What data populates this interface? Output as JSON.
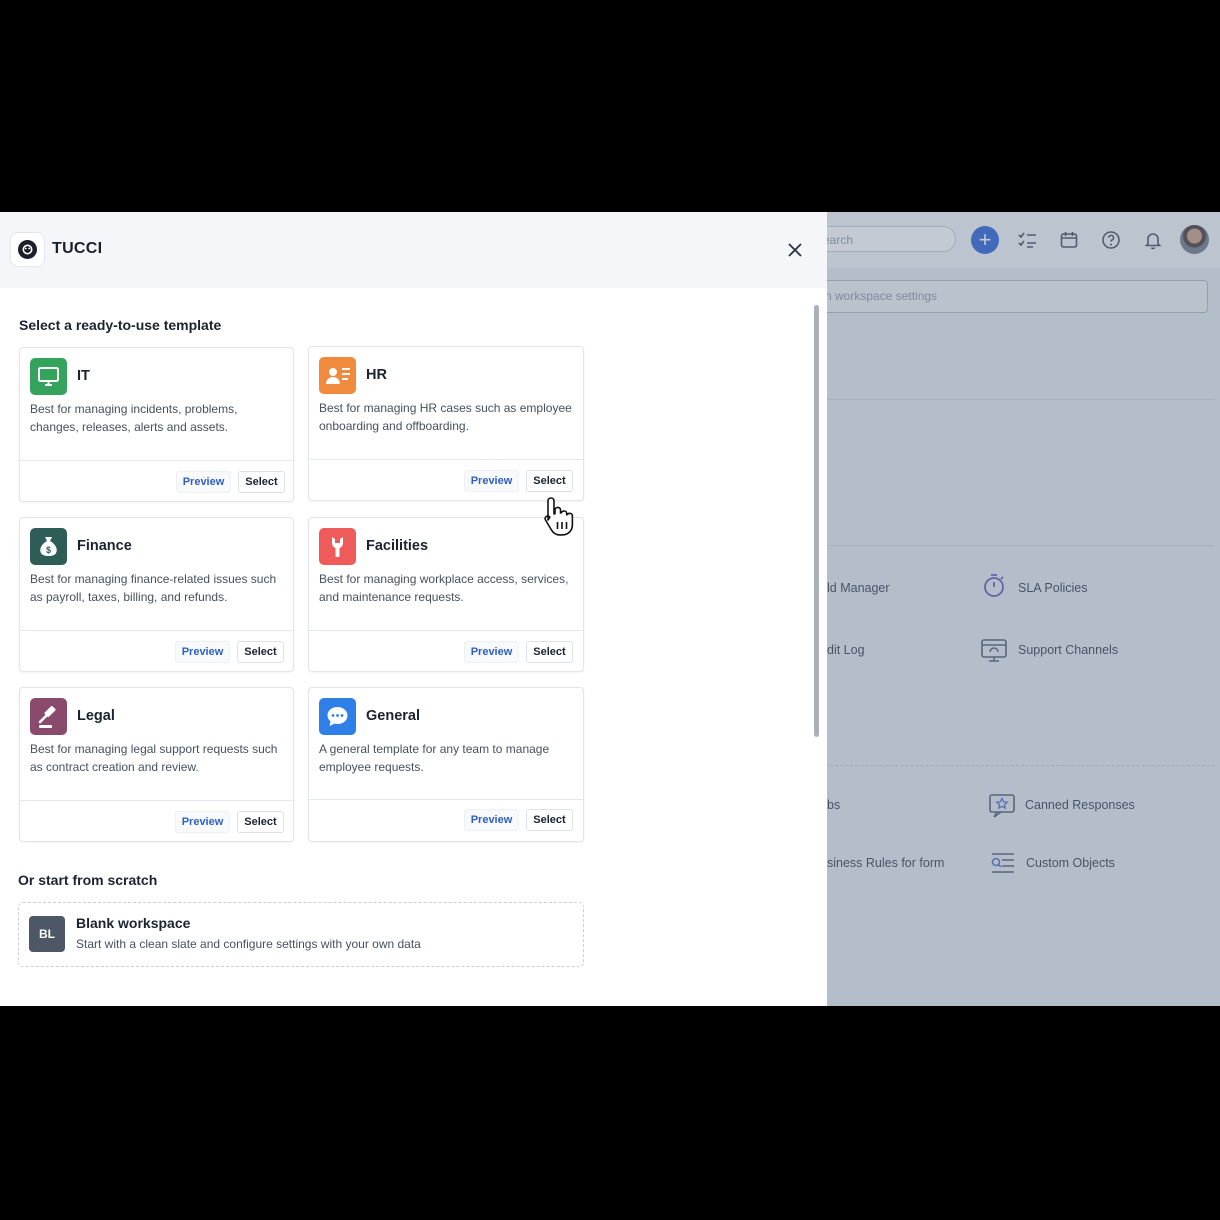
{
  "background_app": {
    "search_placeholder": "earch",
    "settings_search_placeholder": "rch workspace settings",
    "items": [
      {
        "label": "ld Manager"
      },
      {
        "label": "SLA Policies",
        "icon": "stopwatch-icon"
      },
      {
        "label": "dit Log"
      },
      {
        "label": "Support Channels",
        "icon": "support-channels-icon"
      },
      {
        "label": "bs"
      },
      {
        "label": "Canned Responses",
        "icon": "canned-responses-icon"
      },
      {
        "label": "siness Rules for form"
      },
      {
        "label": "Custom Objects",
        "icon": "custom-objects-icon"
      }
    ]
  },
  "modal": {
    "brand": "TUCCI",
    "section_title": "Select a ready-to-use template",
    "templates": [
      {
        "title": "IT",
        "description": "Best for managing incidents, problems, changes, releases, alerts and assets.",
        "icon": "monitor-icon",
        "color": "#34a35c",
        "preview_label": "Preview",
        "select_label": "Select"
      },
      {
        "title": "HR",
        "description": "Best for managing HR cases such as employee onboarding and offboarding.",
        "icon": "id-card-icon",
        "color": "#f08a3c",
        "preview_label": "Preview",
        "select_label": "Select"
      },
      {
        "title": "Finance",
        "description": "Best for managing finance-related issues such as payroll, taxes, billing, and refunds.",
        "icon": "money-bag-icon",
        "color": "#2e5d57",
        "preview_label": "Preview",
        "select_label": "Select"
      },
      {
        "title": "Facilities",
        "description": "Best for managing workplace access, services, and maintenance requests.",
        "icon": "wrench-icon",
        "color": "#ef5a5a",
        "preview_label": "Preview",
        "select_label": "Select"
      },
      {
        "title": "Legal",
        "description": "Best for managing legal support requests such as contract creation and review.",
        "icon": "gavel-icon",
        "color": "#8a4a6c",
        "preview_label": "Preview",
        "select_label": "Select"
      },
      {
        "title": "General",
        "description": "A general template for any team to manage employee requests.",
        "icon": "chat-bubble-icon",
        "color": "#2f7fe8",
        "preview_label": "Preview",
        "select_label": "Select"
      }
    ],
    "scratch_title": "Or start from scratch",
    "blank": {
      "avatar": "BL",
      "title": "Blank workspace",
      "description": "Start with a clean slate and configure settings with your own data"
    }
  }
}
